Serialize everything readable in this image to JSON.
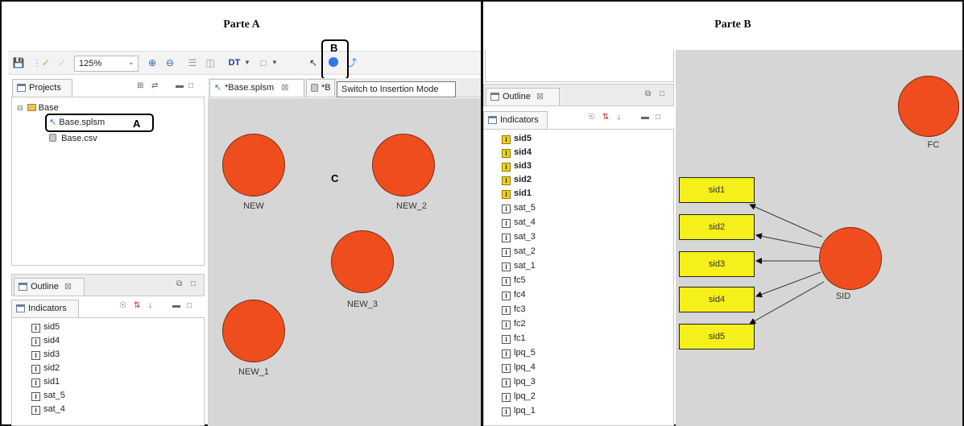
{
  "parte_a": {
    "title": "Parte A",
    "toolbar": {
      "zoom_value": "125%",
      "dt_label": "DT",
      "callout_label": "B"
    },
    "projects_view": {
      "tab_label": "Projects",
      "tree": [
        {
          "label": "Base",
          "kind": "project"
        },
        {
          "label": "Base.splsm",
          "kind": "model",
          "callout": "A"
        },
        {
          "label": "Base.csv",
          "kind": "file"
        }
      ]
    },
    "editor_tabs": [
      {
        "label": "*Base.splsm"
      },
      {
        "label": "*B"
      }
    ],
    "tooltip": "Switch to Insertion Mode",
    "outline_tab": "Outline",
    "indicators_tab": "Indicators",
    "indicators": [
      "sid5",
      "sid4",
      "sid3",
      "sid2",
      "sid1",
      "sat_5",
      "sat_4"
    ],
    "canvas_label": "C",
    "nodes": [
      {
        "label": "NEW"
      },
      {
        "label": "NEW_2"
      },
      {
        "label": "NEW_3"
      },
      {
        "label": "NEW_1"
      }
    ]
  },
  "parte_b": {
    "title": "Parte B",
    "outline_tab": "Outline",
    "indicators_tab": "Indicators",
    "indicators": [
      {
        "label": "sid5",
        "selected": true
      },
      {
        "label": "sid4",
        "selected": true
      },
      {
        "label": "sid3",
        "selected": true
      },
      {
        "label": "sid2",
        "selected": true
      },
      {
        "label": "sid1",
        "selected": true
      },
      {
        "label": "sat_5",
        "selected": false
      },
      {
        "label": "sat_4",
        "selected": false
      },
      {
        "label": "sat_3",
        "selected": false
      },
      {
        "label": "sat_2",
        "selected": false
      },
      {
        "label": "sat_1",
        "selected": false
      },
      {
        "label": "fc5",
        "selected": false
      },
      {
        "label": "fc4",
        "selected": false
      },
      {
        "label": "fc3",
        "selected": false
      },
      {
        "label": "fc2",
        "selected": false
      },
      {
        "label": "fc1",
        "selected": false
      },
      {
        "label": "lpq_5",
        "selected": false
      },
      {
        "label": "lpq_4",
        "selected": false
      },
      {
        "label": "lpq_3",
        "selected": false
      },
      {
        "label": "lpq_2",
        "selected": false
      },
      {
        "label": "lpq_1",
        "selected": false
      }
    ],
    "nodes": [
      {
        "label": "FC"
      },
      {
        "label": "SID"
      }
    ],
    "boxes": [
      "sid1",
      "sid2",
      "sid3",
      "sid4",
      "sid5"
    ]
  },
  "colors": {
    "node_fill": "#f04d1e",
    "indicator_box": "#f5ef1a",
    "canvas": "#d6d6d6"
  }
}
